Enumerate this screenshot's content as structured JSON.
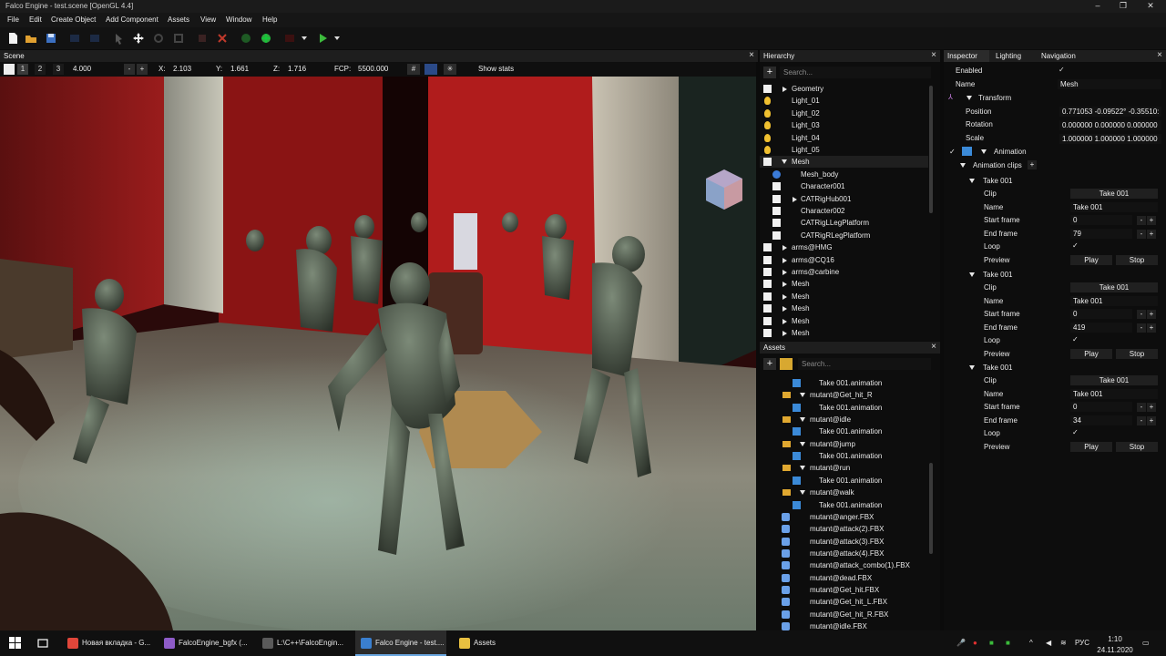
{
  "window": {
    "title": "Falco Engine - test.scene [OpenGL 4.4]"
  },
  "menu": [
    "File",
    "Edit",
    "Create Object",
    "Add Component",
    "Assets",
    "View",
    "Window",
    "Help"
  ],
  "scene": {
    "panel_title": "Scene",
    "layer_buttons": [
      "1",
      "2",
      "3"
    ],
    "speed": "4.000",
    "x_label": "X:",
    "x_value": "2.103",
    "y_label": "Y:",
    "y_value": "1.661",
    "z_label": "Z:",
    "z_value": "1.716",
    "fcp_label": "FCP:",
    "fcp_value": "5500.000",
    "show_stats": "Show stats",
    "minus": "-",
    "plus": "+"
  },
  "hierarchy": {
    "panel_title": "Hierarchy",
    "search_placeholder": "Search...",
    "items": [
      {
        "label": "Geometry",
        "kind": "folder"
      },
      {
        "label": "Light_01",
        "kind": "light"
      },
      {
        "label": "Light_02",
        "kind": "light"
      },
      {
        "label": "Light_03",
        "kind": "light"
      },
      {
        "label": "Light_04",
        "kind": "light"
      },
      {
        "label": "Light_05",
        "kind": "light"
      },
      {
        "label": "Mesh",
        "kind": "expanded"
      },
      {
        "label": "Mesh_body",
        "kind": "mesh"
      },
      {
        "label": "Character001",
        "kind": "child"
      },
      {
        "label": "CATRigHub001",
        "kind": "childfolder"
      },
      {
        "label": "Character002",
        "kind": "child"
      },
      {
        "label": "CATRigLLegPlatform",
        "kind": "child"
      },
      {
        "label": "CATRigRLegPlatform",
        "kind": "child"
      },
      {
        "label": "arms@HMG",
        "kind": "folder"
      },
      {
        "label": "arms@CQ16",
        "kind": "folder"
      },
      {
        "label": "arms@carbine",
        "kind": "folder"
      },
      {
        "label": "Mesh",
        "kind": "folder"
      },
      {
        "label": "Mesh",
        "kind": "folder"
      },
      {
        "label": "Mesh",
        "kind": "folder"
      },
      {
        "label": "Mesh",
        "kind": "folder"
      },
      {
        "label": "Mesh",
        "kind": "folder"
      }
    ]
  },
  "assets": {
    "panel_title": "Assets",
    "search_placeholder": "Search...",
    "items": [
      {
        "label": "Take 001.animation",
        "kind": "anim"
      },
      {
        "label": "mutant@Get_hit_R",
        "kind": "folder"
      },
      {
        "label": "Take 001.animation",
        "kind": "anim"
      },
      {
        "label": "mutant@idle",
        "kind": "folder"
      },
      {
        "label": "Take 001.animation",
        "kind": "anim"
      },
      {
        "label": "mutant@jump",
        "kind": "folder"
      },
      {
        "label": "Take 001.animation",
        "kind": "anim"
      },
      {
        "label": "mutant@run",
        "kind": "folder"
      },
      {
        "label": "Take 001.animation",
        "kind": "anim"
      },
      {
        "label": "mutant@walk",
        "kind": "folder"
      },
      {
        "label": "Take 001.animation",
        "kind": "anim"
      },
      {
        "label": "mutant@anger.FBX",
        "kind": "fbx"
      },
      {
        "label": "mutant@attack(2).FBX",
        "kind": "fbx"
      },
      {
        "label": "mutant@attack(3).FBX",
        "kind": "fbx"
      },
      {
        "label": "mutant@attack(4).FBX",
        "kind": "fbx"
      },
      {
        "label": "mutant@attack_combo(1).FBX",
        "kind": "fbx"
      },
      {
        "label": "mutant@dead.FBX",
        "kind": "fbx"
      },
      {
        "label": "mutant@Get_hit.FBX",
        "kind": "fbx"
      },
      {
        "label": "mutant@Get_hit_L.FBX",
        "kind": "fbx"
      },
      {
        "label": "mutant@Get_hit_R.FBX",
        "kind": "fbx"
      },
      {
        "label": "mutant@idle.FBX",
        "kind": "fbx"
      }
    ]
  },
  "inspector": {
    "tabs": [
      "Inspector",
      "Lighting",
      "Navigation"
    ],
    "enabled_label": "Enabled",
    "name_label": "Name",
    "name_value": "Mesh",
    "transform": {
      "title": "Transform",
      "position_label": "Position",
      "position": "0.771053 -0.09522° -0.35510:",
      "rotation_label": "Rotation",
      "rotation": "0.000000 0.000000 0.000000",
      "scale_label": "Scale",
      "scale": "1.000000 1.000000 1.000000"
    },
    "animation": {
      "title": "Animation",
      "clips_label": "Animation clips",
      "clips": [
        {
          "title": "Take 001",
          "clip": "Take 001",
          "name": "Take 001",
          "start": "0",
          "end": "79"
        },
        {
          "title": "Take 001",
          "clip": "Take 001",
          "name": "Take 001",
          "start": "0",
          "end": "419"
        },
        {
          "title": "Take 001",
          "clip": "Take 001",
          "name": "Take 001",
          "start": "0",
          "end": "34"
        }
      ],
      "clip_label": "Clip",
      "name_label": "Name",
      "start_label": "Start frame",
      "end_label": "End frame",
      "loop_label": "Loop",
      "preview_label": "Preview",
      "play": "Play",
      "stop": "Stop"
    }
  },
  "taskbar": {
    "tasks": [
      {
        "label": "Новая вкладка - G...",
        "color": "#e0463a"
      },
      {
        "label": "FalcoEngine_bgfx (...",
        "color": "#8e5cc8"
      },
      {
        "label": "L:\\C++\\FalcoEngin...",
        "color": "#5a5a5a"
      },
      {
        "label": "Falco Engine - test....",
        "color": "#3a7fcf"
      },
      {
        "label": "Assets",
        "color": "#e8c040"
      }
    ],
    "lang": "РУС",
    "time": "1:10",
    "date": "24.11.2020"
  }
}
